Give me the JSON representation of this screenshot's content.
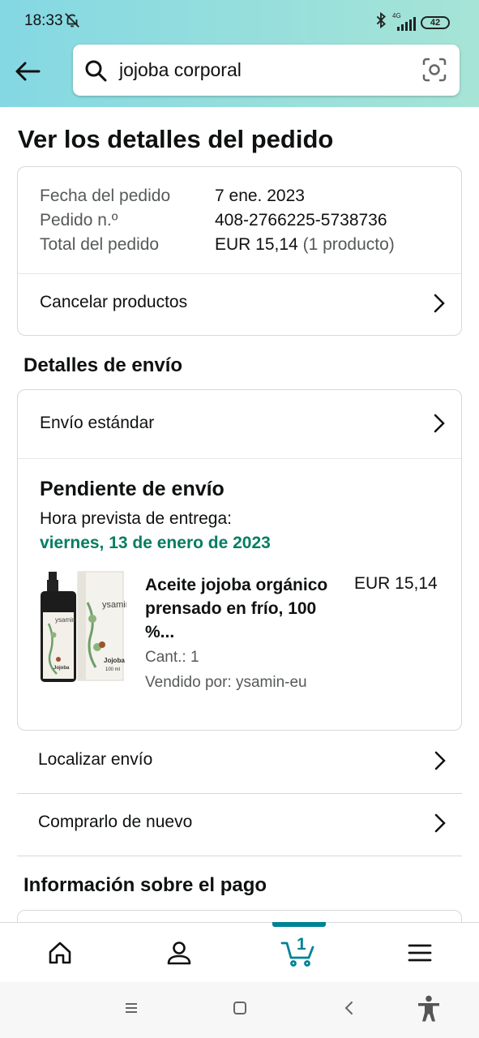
{
  "status_bar": {
    "time": "18:33",
    "network": "4G",
    "battery": "42"
  },
  "search": {
    "query": "jojoba corporal"
  },
  "page": {
    "title": "Ver los detalles del pedido"
  },
  "order_summary": {
    "date_label": "Fecha del pedido",
    "date_value": "7 ene. 2023",
    "number_label": "Pedido n.º",
    "number_value": "408-2766225-5738736",
    "total_label": "Total del pedido",
    "total_value": "EUR 15,14",
    "total_count": "(1 producto)",
    "cancel_label": "Cancelar productos"
  },
  "shipping": {
    "section_title": "Detalles de envío",
    "method": "Envío estándar",
    "status": "Pendiente de envío",
    "eta_label": "Hora prevista de entrega:",
    "eta_date": "viernes, 13 de enero de 2023",
    "product": {
      "name": "Aceite jojoba orgánico prensado en frío, 100 %...",
      "price": "EUR 15,14",
      "quantity": "Cant.: 1",
      "seller": "Vendido por: ysamin-eu",
      "image_label_brand": "ysamin",
      "image_label_product": "Jojoba",
      "image_label_volume": "100 ml"
    }
  },
  "actions": {
    "track": "Localizar envío",
    "buy_again": "Comprarlo de nuevo"
  },
  "payment": {
    "section_title": "Información sobre el pago"
  },
  "bottom_nav": {
    "items": [
      "home-icon",
      "account-icon",
      "cart-icon",
      "menu-icon"
    ],
    "cart_count": "1",
    "active": "cart",
    "accent_color": "#008296"
  },
  "colors": {
    "delivery_green": "#067d62",
    "header_gradient_start": "#84d8e3",
    "header_gradient_end": "#a6e4d6"
  }
}
